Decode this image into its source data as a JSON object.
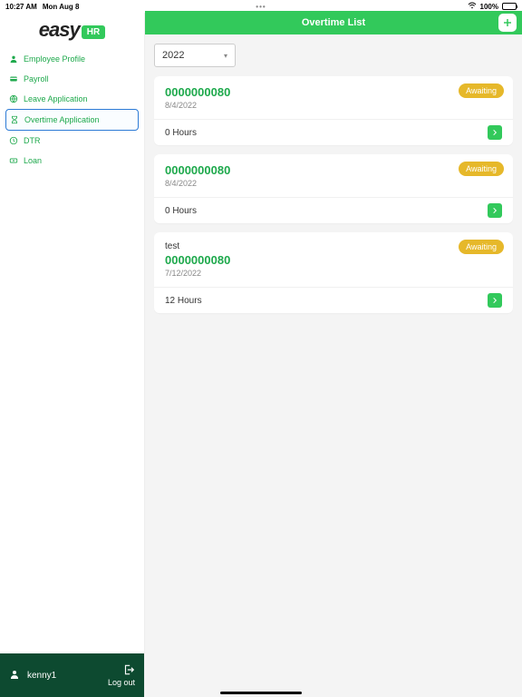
{
  "status": {
    "time": "10:27 AM",
    "date": "Mon Aug 8",
    "dots": "•••",
    "battery_pct": "100%"
  },
  "brand": {
    "name": "easy",
    "badge": "HR"
  },
  "nav": {
    "items": [
      {
        "label": "Employee Profile"
      },
      {
        "label": "Payroll"
      },
      {
        "label": "Leave Application"
      },
      {
        "label": "Overtime Application"
      },
      {
        "label": "DTR"
      },
      {
        "label": "Loan"
      }
    ]
  },
  "user": {
    "name": "kenny1",
    "logout": "Log out"
  },
  "header": {
    "title": "Overtime List"
  },
  "filter": {
    "year": "2022"
  },
  "cards": [
    {
      "title": "",
      "id": "0000000080",
      "date": "8/4/2022",
      "hours": "0 Hours",
      "status": "Awaiting"
    },
    {
      "title": "",
      "id": "0000000080",
      "date": "8/4/2022",
      "hours": "0 Hours",
      "status": "Awaiting"
    },
    {
      "title": "test",
      "id": "0000000080",
      "date": "7/12/2022",
      "hours": "12 Hours",
      "status": "Awaiting"
    }
  ]
}
